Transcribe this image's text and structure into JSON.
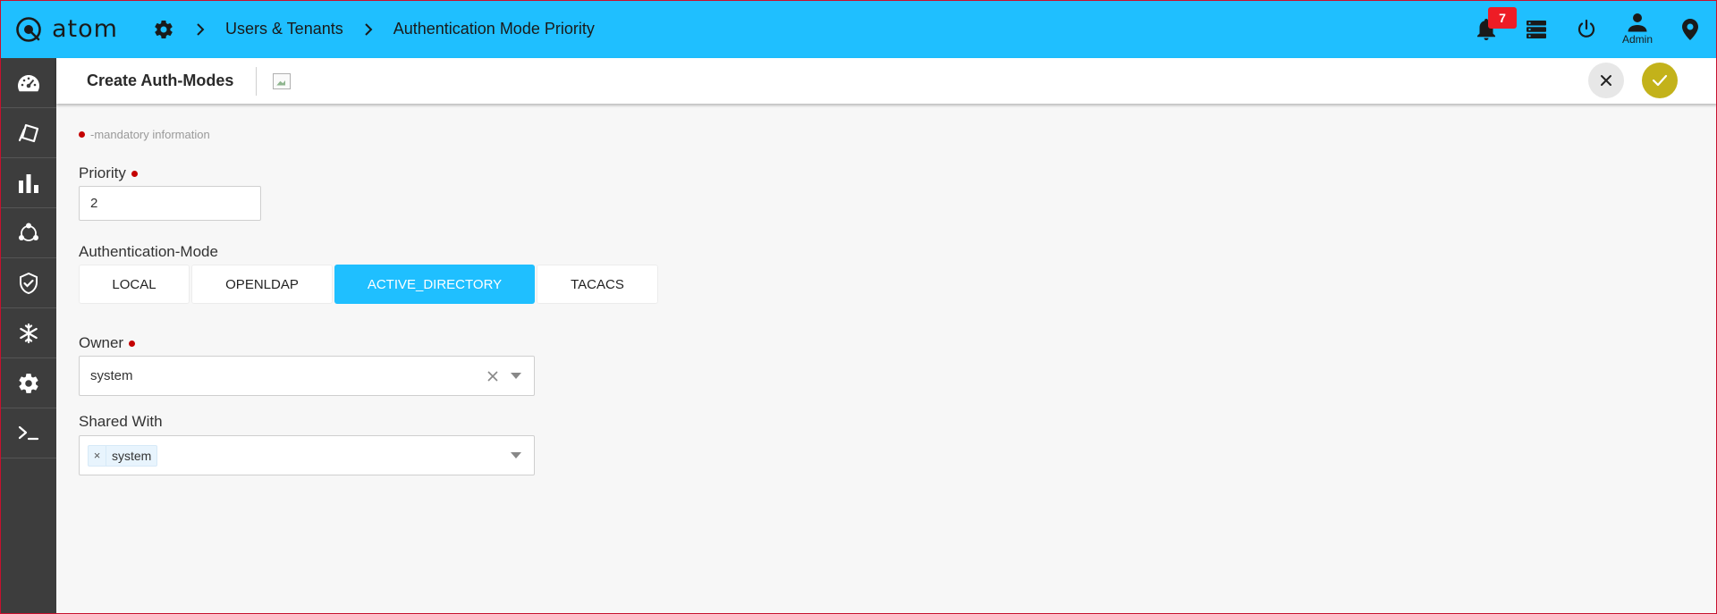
{
  "app": {
    "brand": "atom"
  },
  "breadcrumb": {
    "items": [
      "Users & Tenants",
      "Authentication Mode Priority"
    ]
  },
  "topbar": {
    "notification_count": "7",
    "user_label": "Admin"
  },
  "sidebar": {
    "icons": [
      "dashboard-icon",
      "devices-icon",
      "analytics-icon",
      "topology-icon",
      "security-shield-icon",
      "snowflake-icon",
      "settings-gear-icon",
      "terminal-icon"
    ]
  },
  "header": {
    "title": "Create Auth-Modes"
  },
  "form": {
    "mandatory_note": "-mandatory information",
    "priority": {
      "label": "Priority",
      "value": "2"
    },
    "auth_mode": {
      "label": "Authentication-Mode",
      "options": [
        "LOCAL",
        "OPENLDAP",
        "ACTIVE_DIRECTORY",
        "TACACS"
      ],
      "selected": "ACTIVE_DIRECTORY"
    },
    "owner": {
      "label": "Owner",
      "value": "system"
    },
    "shared_with": {
      "label": "Shared With",
      "chips": [
        "system"
      ],
      "chip_remove": "×"
    }
  },
  "colors": {
    "topbar": "#1fbfff",
    "sidebar": "#3d3d3d",
    "accent_active": "#1fbfff",
    "confirm": "#c3b21a",
    "mandatory_dot": "#c40000",
    "badge": "#ee1c25"
  }
}
